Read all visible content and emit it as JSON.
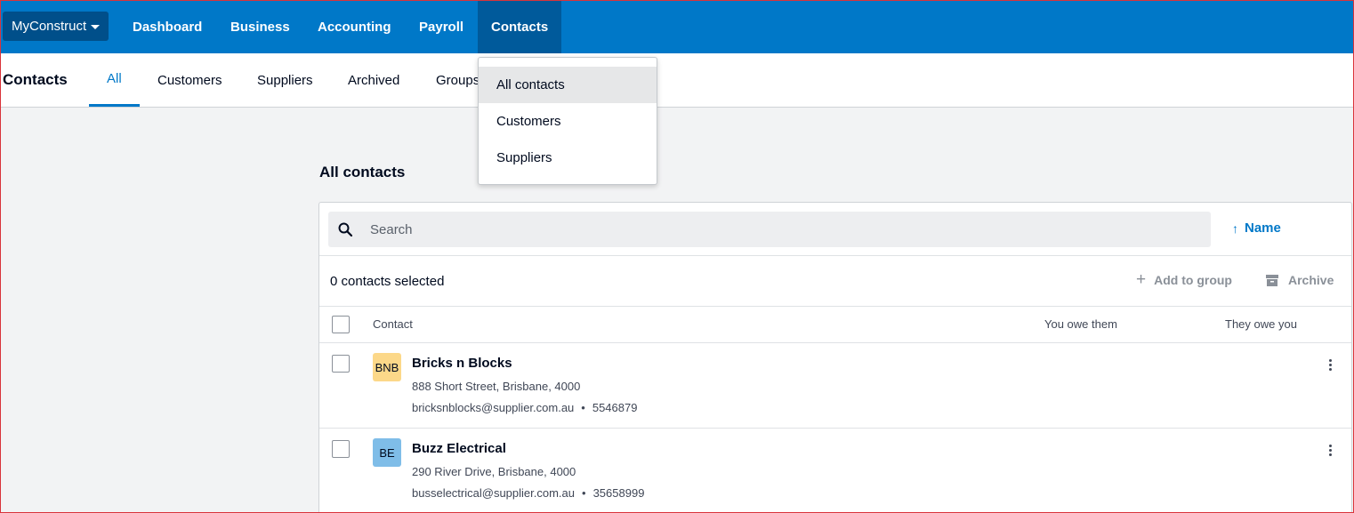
{
  "topnav": {
    "org_name": "MyConstruct",
    "items": [
      "Dashboard",
      "Business",
      "Accounting",
      "Payroll",
      "Contacts"
    ],
    "active": "Contacts"
  },
  "subnav": {
    "title": "Contacts",
    "tabs": [
      "All",
      "Customers",
      "Suppliers",
      "Archived",
      "Groups"
    ],
    "active": "All"
  },
  "dropdown": {
    "items": [
      "All contacts",
      "Customers",
      "Suppliers"
    ],
    "highlighted": "All contacts"
  },
  "main": {
    "title": "All contacts",
    "search_placeholder": "Search",
    "sort_label": "Name",
    "selected_count": "0 contacts selected",
    "add_to_group_label": "Add to group",
    "archive_label": "Archive",
    "columns": {
      "contact": "Contact",
      "you_owe": "You owe them",
      "they_owe": "They owe you"
    },
    "contacts": [
      {
        "initials": "BNB",
        "avatar_color": "#fcd889",
        "name": "Bricks n Blocks",
        "address": "888 Short Street, Brisbane, 4000",
        "email": "bricksnblocks@supplier.com.au",
        "phone": "5546879"
      },
      {
        "initials": "BE",
        "avatar_color": "#7fbde8",
        "name": "Buzz Electrical",
        "address": "290 River Drive, Brisbane, 4000",
        "email": "busselectrical@supplier.com.au",
        "phone": "35658999"
      }
    ]
  },
  "colors": {
    "brand": "#0078c8",
    "brand_dark": "#004f8a",
    "active_nav": "#005a9b"
  }
}
